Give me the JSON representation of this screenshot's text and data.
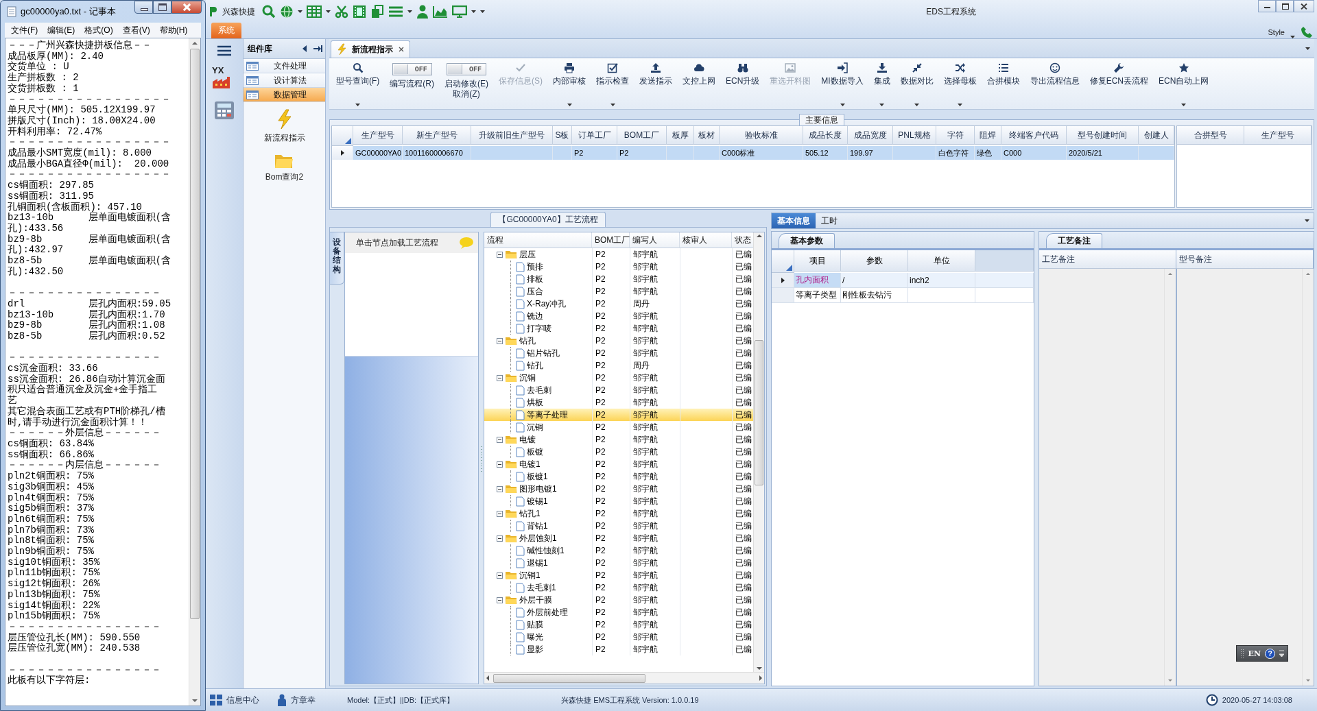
{
  "notepad": {
    "title": "gc00000ya0.txt - 记事本",
    "menu": [
      "文件(F)",
      "编辑(E)",
      "格式(O)",
      "查看(V)",
      "帮助(H)"
    ],
    "blocks": [
      [
        "－－－广州兴森快捷拼板信息－－",
        "成品板厚(MM): 2.40",
        "交货单位 : U",
        "生产拼板数 : 2",
        "交货拼板数 : 1",
        "－－－－－－－－－－－－－－－－－",
        "单只尺寸(MM): 505.12X199.97",
        "拼版尺寸(Inch): 18.00X24.00",
        "开料利用率: 72.47%",
        "－－－－－－－－－－－－－－－－－",
        "成品最小SMT宽度(mil): 8.000",
        "成品最小BGA直径Φ(mil):  20.000",
        "－－－－－－－－－－－－－－－－－",
        "cs铜面积: 297.85",
        "ss铜面积: 311.95",
        "孔铜面积(含板面积): 457.10",
        "bz13-10b\t层单面电镀面积(含",
        "孔):433.56",
        "bz9-8b\t层单面电镀面积(含",
        "孔):432.97",
        "bz8-5b\t层单面电镀面积(含",
        "孔):432.50"
      ],
      [
        "－－－－－－－－－－－－－－－－",
        "drl\t层孔内面积:59.05",
        "bz13-10b\t层孔内面积:1.70",
        "bz9-8b\t层孔内面积:1.08",
        "bz8-5b\t层孔内面积:0.52"
      ],
      [
        "－－－－－－－－－－－－－－－－",
        "cs沉金面积: 33.66",
        "ss沉金面积: 26.86自动计算沉金面",
        "积只适合普通沉金及沉金+金手指工",
        "艺",
        "其它混合表面工艺或有PTH阶梯孔/槽",
        "时,请手动进行沉金面积计算！！",
        "－－－－－－外层信息－－－－－－",
        "cs铜面积: 63.84%",
        "ss铜面积: 66.86%",
        "－－－－－－内层信息－－－－－－",
        "pln2t铜面积: 75%",
        "sig3b铜面积: 45%",
        "pln4t铜面积: 75%",
        "sig5b铜面积: 37%",
        "pln6t铜面积: 75%",
        "pln7b铜面积: 73%",
        "pln8t铜面积: 75%",
        "pln9b铜面积: 75%",
        "sig10t铜面积: 35%",
        "pln11b铜面积: 75%",
        "sig12t铜面积: 26%",
        "pln13b铜面积: 75%",
        "sig14t铜面积: 22%",
        "pln15b铜面积: 75%",
        "－－－－－－－－－－－－－－－－",
        "层压管位孔长(MM): 590.550",
        "层压管位孔宽(MM): 240.538"
      ],
      [
        "－－－－－－－－－－－－－－－－",
        "此板有以下字符层:"
      ]
    ]
  },
  "app": {
    "quick_label": "兴森快捷",
    "title": "EDS工程系统",
    "ribbon_tab": "系统",
    "style_label": "Style",
    "launcher_text": "YX"
  },
  "library": {
    "title": "组件库",
    "items": [
      {
        "label": "文件处理",
        "selected": false
      },
      {
        "label": "设计算法",
        "selected": false
      },
      {
        "label": "数据管理",
        "selected": true
      }
    ],
    "tools": [
      {
        "label": "新流程指示"
      },
      {
        "label": "Bom查询2"
      }
    ]
  },
  "document_tab": {
    "label": "新流程指示"
  },
  "toolbar": [
    {
      "kind": "button",
      "label": "型号查询(F)",
      "dropdown": true,
      "disabled": false
    },
    {
      "kind": "toggle",
      "label": "编写流程(R)",
      "switch_text": "OFF",
      "on": false
    },
    {
      "kind": "toggle",
      "label": "启动修改(E)\n取消(Z)",
      "switch_text": "OFF",
      "on": false
    },
    {
      "kind": "button",
      "label": "保存信息(S)",
      "dropdown": false,
      "disabled": true
    },
    {
      "kind": "button",
      "label": "内部审核",
      "dropdown": true,
      "disabled": false
    },
    {
      "kind": "button",
      "label": "指示检查",
      "dropdown": true,
      "disabled": false
    },
    {
      "kind": "button",
      "label": "发送指示",
      "dropdown": false,
      "disabled": false
    },
    {
      "kind": "button",
      "label": "文控上网",
      "dropdown": false,
      "disabled": false
    },
    {
      "kind": "button",
      "label": "ECN升级",
      "dropdown": false,
      "disabled": false
    },
    {
      "kind": "button",
      "label": "重选开料图",
      "dropdown": false,
      "disabled": true
    },
    {
      "kind": "button",
      "label": "MI数据导入",
      "dropdown": true,
      "disabled": false
    },
    {
      "kind": "button",
      "label": "集成",
      "dropdown": true,
      "disabled": false
    },
    {
      "kind": "button",
      "label": "数据对比",
      "dropdown": true,
      "disabled": false
    },
    {
      "kind": "button",
      "label": "选择母板",
      "dropdown": true,
      "disabled": false
    },
    {
      "kind": "button",
      "label": "合拼模块",
      "dropdown": false,
      "disabled": false
    },
    {
      "kind": "button",
      "label": "导出流程信息",
      "dropdown": false,
      "disabled": false
    },
    {
      "kind": "button",
      "label": "修复ECN丢流程",
      "dropdown": false,
      "disabled": false
    },
    {
      "kind": "button",
      "label": "ECN自动上网",
      "dropdown": true,
      "disabled": false
    }
  ],
  "main_info": {
    "title": "主要信息",
    "columns": [
      "生产型号",
      "新生产型号",
      "升级前旧生产型号",
      "S板",
      "订单工厂",
      "BOM工厂",
      "板厚",
      "板材",
      "验收标准",
      "成品长度",
      "成品宽度",
      "PNL规格",
      "字符",
      "阻焊",
      "终端客户代码",
      "型号创建时间",
      "创建人"
    ],
    "rows": [
      {
        "selected": true,
        "cells": [
          "GC00000YA0",
          "10011600006670",
          null,
          null,
          "P2",
          "P2",
          null,
          null,
          "C000标准",
          "505.12",
          "199.97",
          null,
          "白色字符",
          "绿色",
          "C000",
          "2020/5/21",
          null
        ]
      }
    ],
    "side_columns": [
      "合拼型号",
      "生产型号"
    ]
  },
  "flow": {
    "title": "【GC00000YA0】工艺流程",
    "side_tab": "设备结构",
    "hint": "单击节点加载工艺流程",
    "columns": [
      "流程",
      "BOM工厂",
      "编写人",
      "核审人",
      "状态"
    ],
    "rows": [
      {
        "kind": "folder",
        "name": "层压",
        "bom": "P2",
        "author": "邹宇航",
        "status": "已编",
        "selected": false,
        "expanded": true,
        "children": [
          {
            "kind": "step",
            "name": "预排",
            "bom": "P2",
            "author": "邹宇航",
            "status": "已编",
            "selected": false
          },
          {
            "kind": "step",
            "name": "排板",
            "bom": "P2",
            "author": "邹宇航",
            "status": "已编",
            "selected": false
          },
          {
            "kind": "step",
            "name": "压合",
            "bom": "P2",
            "author": "邹宇航",
            "status": "已编",
            "selected": false
          },
          {
            "kind": "step",
            "name": "X-Ray冲孔",
            "bom": "P2",
            "author": "周丹",
            "status": "已编",
            "selected": false
          },
          {
            "kind": "step",
            "name": "铣边",
            "bom": "P2",
            "author": "邹宇航",
            "status": "已编",
            "selected": false
          },
          {
            "kind": "step",
            "name": "打字唛",
            "bom": "P2",
            "author": "邹宇航",
            "status": "已编",
            "selected": false
          }
        ]
      },
      {
        "kind": "folder",
        "name": "钻孔",
        "bom": "P2",
        "author": "邹宇航",
        "status": "已编",
        "selected": false,
        "expanded": true,
        "children": [
          {
            "kind": "step",
            "name": "铝片钻孔",
            "bom": "P2",
            "author": "邹宇航",
            "status": "已编",
            "selected": false
          },
          {
            "kind": "step",
            "name": "钻孔",
            "bom": "P2",
            "author": "周丹",
            "status": "已编",
            "selected": false
          }
        ]
      },
      {
        "kind": "folder",
        "name": "沉铜",
        "bom": "P2",
        "author": "邹宇航",
        "status": "已编",
        "selected": false,
        "expanded": true,
        "children": [
          {
            "kind": "step",
            "name": "去毛刺",
            "bom": "P2",
            "author": "邹宇航",
            "status": "已编",
            "selected": false
          },
          {
            "kind": "step",
            "name": "烘板",
            "bom": "P2",
            "author": "邹宇航",
            "status": "已编",
            "selected": false
          },
          {
            "kind": "step",
            "name": "等离子处理",
            "bom": "P2",
            "author": "邹宇航",
            "status": "已编",
            "selected": true
          },
          {
            "kind": "step",
            "name": "沉铜",
            "bom": "P2",
            "author": "邹宇航",
            "status": "已编",
            "selected": false
          }
        ]
      },
      {
        "kind": "folder",
        "name": "电镀",
        "bom": "P2",
        "author": "邹宇航",
        "status": "已编",
        "selected": false,
        "expanded": true,
        "children": [
          {
            "kind": "step",
            "name": "板镀",
            "bom": "P2",
            "author": "邹宇航",
            "status": "已编",
            "selected": false
          }
        ]
      },
      {
        "kind": "folder",
        "name": "电镀1",
        "bom": "P2",
        "author": "邹宇航",
        "status": "已编",
        "selected": false,
        "expanded": true,
        "children": [
          {
            "kind": "step",
            "name": "板镀1",
            "bom": "P2",
            "author": "邹宇航",
            "status": "已编",
            "selected": false
          }
        ]
      },
      {
        "kind": "folder",
        "name": "图形电镀1",
        "bom": "P2",
        "author": "邹宇航",
        "status": "已编",
        "selected": false,
        "expanded": true,
        "children": [
          {
            "kind": "step",
            "name": "镀锡1",
            "bom": "P2",
            "author": "邹宇航",
            "status": "已编",
            "selected": false
          }
        ]
      },
      {
        "kind": "folder",
        "name": "钻孔1",
        "bom": "P2",
        "author": "邹宇航",
        "status": "已编",
        "selected": false,
        "expanded": true,
        "children": [
          {
            "kind": "step",
            "name": "背钻1",
            "bom": "P2",
            "author": "邹宇航",
            "status": "已编",
            "selected": false
          }
        ]
      },
      {
        "kind": "folder",
        "name": "外层蚀刻1",
        "bom": "P2",
        "author": "邹宇航",
        "status": "已编",
        "selected": false,
        "expanded": true,
        "children": [
          {
            "kind": "step",
            "name": "碱性蚀刻1",
            "bom": "P2",
            "author": "邹宇航",
            "status": "已编",
            "selected": false
          },
          {
            "kind": "step",
            "name": "退锡1",
            "bom": "P2",
            "author": "邹宇航",
            "status": "已编",
            "selected": false
          }
        ]
      },
      {
        "kind": "folder",
        "name": "沉铜1",
        "bom": "P2",
        "author": "邹宇航",
        "status": "已编",
        "selected": false,
        "expanded": true,
        "children": [
          {
            "kind": "step",
            "name": "去毛刺1",
            "bom": "P2",
            "author": "邹宇航",
            "status": "已编",
            "selected": false
          }
        ]
      },
      {
        "kind": "folder",
        "name": "外层干膜",
        "bom": "P2",
        "author": "邹宇航",
        "status": "已编",
        "selected": false,
        "expanded": true,
        "children": [
          {
            "kind": "step",
            "name": "外层前处理",
            "bom": "P2",
            "author": "邹宇航",
            "status": "已编",
            "selected": false
          },
          {
            "kind": "step",
            "name": "贴膜",
            "bom": "P2",
            "author": "邹宇航",
            "status": "已编",
            "selected": false
          },
          {
            "kind": "step",
            "name": "曝光",
            "bom": "P2",
            "author": "邹宇航",
            "status": "已编",
            "selected": false
          },
          {
            "kind": "step",
            "name": "显影",
            "bom": "P2",
            "author": "邹宇航",
            "status": "已编",
            "selected": false
          }
        ]
      }
    ]
  },
  "detail": {
    "tabs": [
      {
        "label": "基本信息",
        "selected": true
      },
      {
        "label": "工时",
        "selected": false
      }
    ],
    "params_tab": "基本参数",
    "param_columns": [
      "项目",
      "参数",
      "单位"
    ],
    "params": [
      {
        "item": "孔内面积",
        "value": "/",
        "unit": "inch2",
        "selected": true
      },
      {
        "item": "等离子类型",
        "value": "刚性板去钻污",
        "selected": false
      }
    ],
    "remarks_tab": "工艺备注",
    "remark_columns": [
      "工艺备注",
      "型号备注"
    ]
  },
  "language_bar": {
    "label": "EN",
    "help": "?"
  },
  "status_bar": {
    "info_center": "信息中心",
    "user": "方章幸",
    "model_db": "Model:【正式】||DB:【正式库】",
    "version": "兴森快捷 EMS工程系统 Version: 1.0.0.19",
    "datetime": "2020-05-27 14:03:08"
  }
}
